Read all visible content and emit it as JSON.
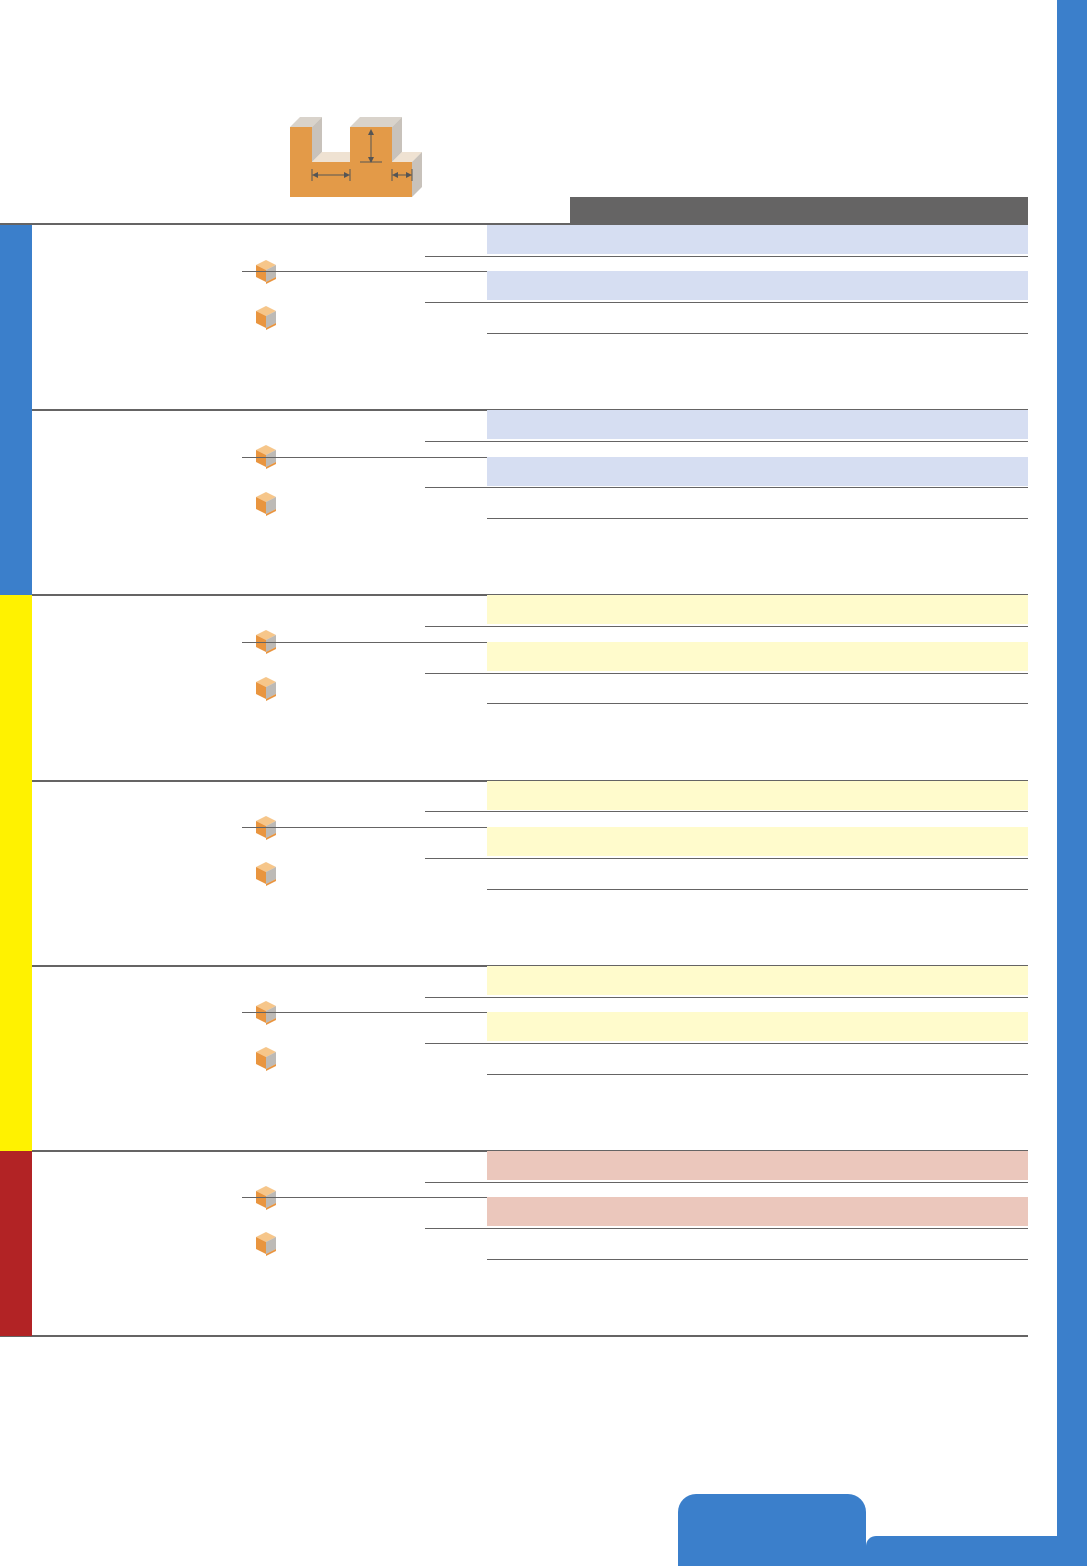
{
  "colors": {
    "accent_blue": "#3b7fcb",
    "header_gray": "#656464",
    "blue_band": "#d6def2",
    "yellow_band": "#fffbcc",
    "red_band": "#ebc7bc",
    "blue_edge": "#3b7fcb",
    "yellow_edge": "#fff200",
    "red_edge": "#b22325",
    "profile_orange": "#e39a48",
    "profile_light": "#efe2d2"
  },
  "header": {
    "profile_illustration": "slot-profile-diagram",
    "icon": "dimension-profile-icon"
  },
  "groups": [
    {
      "color": "blue",
      "subgroups": 2,
      "rows": [
        {
          "icon": "material-cube-icon"
        },
        {
          "icon": "material-cube-icon"
        },
        {
          "icon": "material-cube-icon"
        },
        {
          "icon": "material-cube-icon"
        }
      ]
    },
    {
      "color": "yellow",
      "subgroups": 3,
      "rows": [
        {
          "icon": "material-cube-icon"
        },
        {
          "icon": "material-cube-icon"
        },
        {
          "icon": "material-cube-icon"
        },
        {
          "icon": "material-cube-icon"
        },
        {
          "icon": "material-cube-icon"
        },
        {
          "icon": "material-cube-icon"
        }
      ]
    },
    {
      "color": "red",
      "subgroups": 1,
      "rows": [
        {
          "icon": "material-cube-icon"
        },
        {
          "icon": "material-cube-icon"
        }
      ]
    }
  ]
}
